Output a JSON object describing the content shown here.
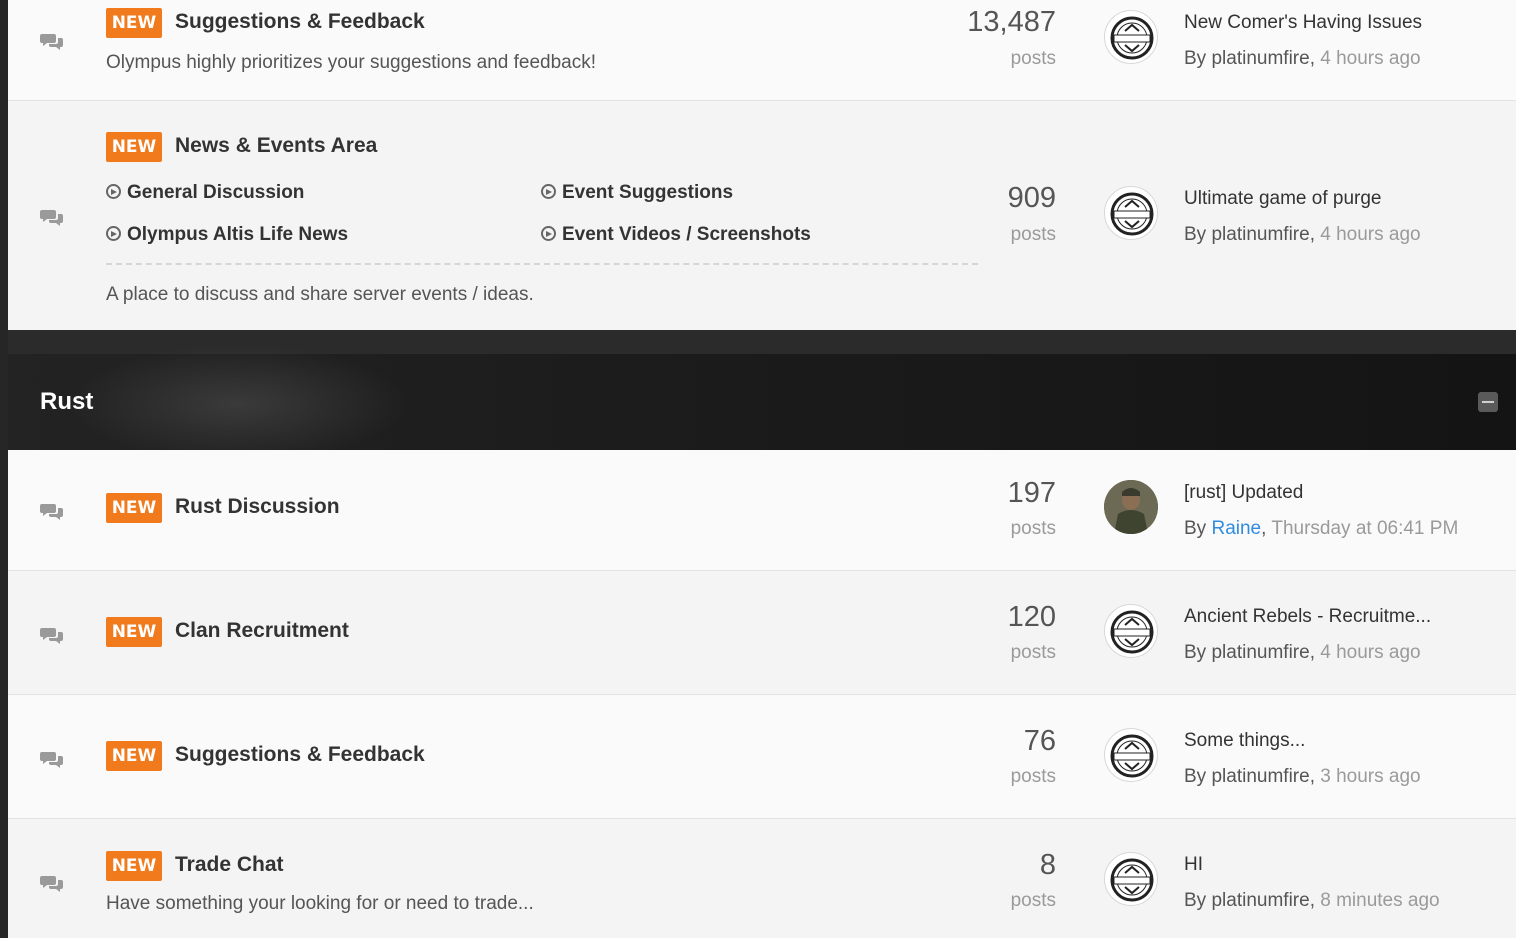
{
  "icons": {
    "topbar_left": "gold-diamond-icon",
    "forum_row": "chat-bubbles-icon",
    "subforum": "circle-arrow-icon",
    "collapse": "minus-square-icon"
  },
  "colors": {
    "badge": "#f07a1c",
    "link": "#2f8ce0"
  },
  "forums_top": [
    {
      "badge": "NEW",
      "title": "Suggestions & Feedback",
      "description": "Olympus highly prioritizes your suggestions and feedback!",
      "count": "13,487",
      "count_label": "posts",
      "last_title": "New Comer's Having Issues",
      "last_by_prefix": "By",
      "last_by": "platinumfire",
      "last_when": "4 hours ago"
    },
    {
      "badge": "NEW",
      "title": "News & Events Area",
      "subforums": [
        "General Discussion",
        "Event Suggestions",
        "Olympus Altis Life News",
        "Event Videos / Screenshots"
      ],
      "description": "A place to discuss and share server events / ideas.",
      "count": "909",
      "count_label": "posts",
      "last_title": "Ultimate game of purge",
      "last_by_prefix": "By",
      "last_by": "platinumfire",
      "last_when": "4 hours ago"
    }
  ],
  "category": {
    "title": "Rust"
  },
  "forums_rust": [
    {
      "badge": "NEW",
      "title": "Rust Discussion",
      "count": "197",
      "count_label": "posts",
      "last_title": "[rust] Updated",
      "last_by_prefix": "By",
      "last_by": "Raine",
      "last_when": "Thursday at 06:41 PM"
    },
    {
      "badge": "NEW",
      "title": "Clan Recruitment",
      "count": "120",
      "count_label": "posts",
      "last_title": "Ancient Rebels - Recruitme...",
      "last_by_prefix": "By",
      "last_by": "platinumfire",
      "last_when": "4 hours ago"
    },
    {
      "badge": "NEW",
      "title": "Suggestions & Feedback",
      "count": "76",
      "count_label": "posts",
      "last_title": "Some things...",
      "last_by_prefix": "By",
      "last_by": "platinumfire",
      "last_when": "3 hours ago"
    },
    {
      "badge": "NEW",
      "title": "Trade Chat",
      "description": "Have something your looking for or need to trade...",
      "count": "8",
      "count_label": "posts",
      "last_title": "HI",
      "last_by_prefix": "By",
      "last_by": "platinumfire",
      "last_when": "8 minutes ago"
    }
  ]
}
